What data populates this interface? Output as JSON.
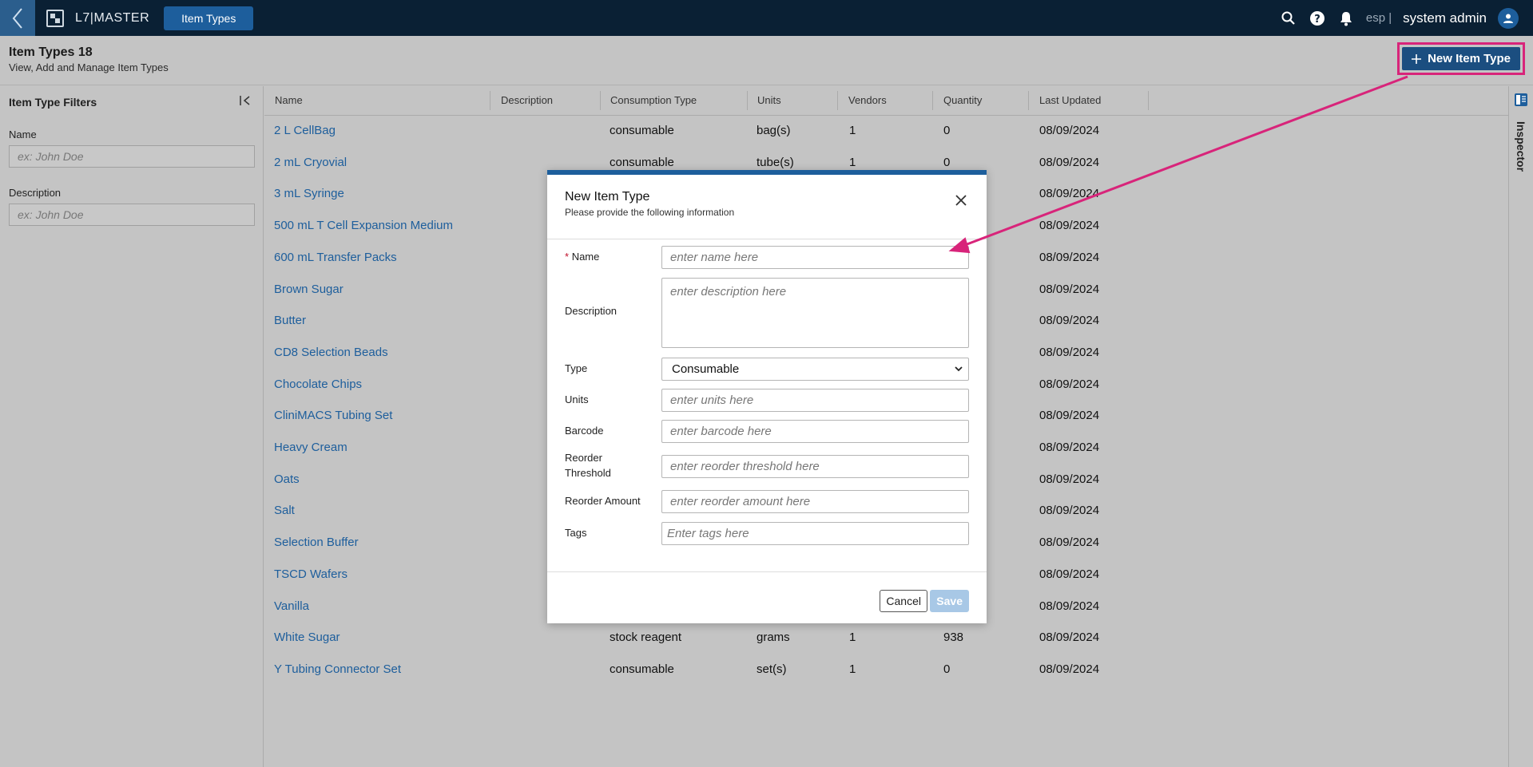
{
  "topbar": {
    "app_name": "L7|MASTER",
    "active_tab": "Item Types",
    "lang": "esp |",
    "user": "system admin"
  },
  "header": {
    "title": "Item Types 18",
    "subtitle": "View, Add and Manage Item Types",
    "new_button": "New Item Type"
  },
  "sidebar": {
    "title": "Item Type Filters",
    "name_label": "Name",
    "name_placeholder": "ex: John Doe",
    "description_label": "Description",
    "description_placeholder": "ex: John Doe"
  },
  "table": {
    "columns": [
      "Name",
      "Description",
      "Consumption Type",
      "Units",
      "Vendors",
      "Quantity",
      "Last Updated"
    ],
    "rows": [
      {
        "name": "2 L CellBag",
        "consumption": "consumable",
        "units": "bag(s)",
        "vendors": "1",
        "quantity": "0",
        "updated": "08/09/2024"
      },
      {
        "name": "2 mL Cryovial",
        "consumption": "consumable",
        "units": "tube(s)",
        "vendors": "1",
        "quantity": "0",
        "updated": "08/09/2024"
      },
      {
        "name": "3 mL Syringe",
        "consumption": "",
        "units": "",
        "vendors": "",
        "quantity": "",
        "updated": "08/09/2024"
      },
      {
        "name": "500 mL T Cell Expansion Medium",
        "consumption": "",
        "units": "",
        "vendors": "",
        "quantity": "",
        "updated": "08/09/2024"
      },
      {
        "name": "600 mL Transfer Packs",
        "consumption": "",
        "units": "",
        "vendors": "",
        "quantity": "",
        "updated": "08/09/2024"
      },
      {
        "name": "Brown Sugar",
        "consumption": "",
        "units": "",
        "vendors": "",
        "quantity": "",
        "updated": "08/09/2024"
      },
      {
        "name": "Butter",
        "consumption": "",
        "units": "",
        "vendors": "",
        "quantity": "",
        "updated": "08/09/2024"
      },
      {
        "name": "CD8 Selection Beads",
        "consumption": "",
        "units": "",
        "vendors": "",
        "quantity": "",
        "updated": "08/09/2024"
      },
      {
        "name": "Chocolate Chips",
        "consumption": "",
        "units": "",
        "vendors": "",
        "quantity": "",
        "updated": "08/09/2024"
      },
      {
        "name": "CliniMACS Tubing Set",
        "consumption": "",
        "units": "",
        "vendors": "",
        "quantity": "",
        "updated": "08/09/2024"
      },
      {
        "name": "Heavy Cream",
        "consumption": "",
        "units": "",
        "vendors": "",
        "quantity": "",
        "updated": "08/09/2024"
      },
      {
        "name": "Oats",
        "consumption": "",
        "units": "",
        "vendors": "",
        "quantity": "",
        "updated": "08/09/2024"
      },
      {
        "name": "Salt",
        "consumption": "",
        "units": "",
        "vendors": "",
        "quantity": "",
        "updated": "08/09/2024"
      },
      {
        "name": "Selection Buffer",
        "consumption": "",
        "units": "",
        "vendors": "",
        "quantity": "",
        "updated": "08/09/2024"
      },
      {
        "name": "TSCD Wafers",
        "consumption": "",
        "units": "",
        "vendors": "",
        "quantity": "",
        "updated": "08/09/2024"
      },
      {
        "name": "Vanilla",
        "consumption": "",
        "units": "",
        "vendors": "",
        "quantity": "",
        "updated": "08/09/2024"
      },
      {
        "name": "White Sugar",
        "consumption": "stock reagent",
        "units": "grams",
        "vendors": "1",
        "quantity": "938",
        "updated": "08/09/2024"
      },
      {
        "name": "Y Tubing Connector Set",
        "consumption": "consumable",
        "units": "set(s)",
        "vendors": "1",
        "quantity": "0",
        "updated": "08/09/2024"
      }
    ]
  },
  "inspector": {
    "label": "Inspector"
  },
  "modal": {
    "title": "New Item Type",
    "subtitle": "Please provide the following information",
    "required_mark": "*",
    "fields": {
      "name": {
        "label": "Name",
        "placeholder": "enter name here"
      },
      "description": {
        "label": "Description",
        "placeholder": "enter description here"
      },
      "type": {
        "label": "Type",
        "value": "Consumable"
      },
      "units": {
        "label": "Units",
        "placeholder": "enter units here"
      },
      "barcode": {
        "label": "Barcode",
        "placeholder": "enter barcode here"
      },
      "reorder_threshold": {
        "label_line1": "Reorder",
        "label_line2": "Threshold",
        "placeholder": "enter reorder threshold here"
      },
      "reorder_amount": {
        "label": "Reorder Amount",
        "placeholder": "enter reorder amount here"
      },
      "tags": {
        "label": "Tags",
        "placeholder": "Enter tags here"
      }
    },
    "cancel": "Cancel",
    "save": "Save"
  },
  "colors": {
    "accent": "#1d5e9c",
    "annotation": "#d8247a",
    "topbar": "#0a2034"
  }
}
